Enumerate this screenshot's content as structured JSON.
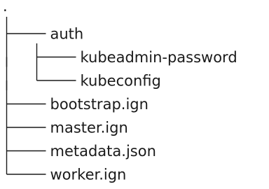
{
  "tree": {
    "root": ".",
    "items": [
      {
        "label": "auth",
        "depth": 0,
        "kind": "dir",
        "last": false
      },
      {
        "label": "kubeadmin-password",
        "depth": 1,
        "kind": "file",
        "last": false
      },
      {
        "label": "kubeconfig",
        "depth": 1,
        "kind": "file",
        "last": true
      },
      {
        "label": "bootstrap.ign",
        "depth": 0,
        "kind": "file",
        "last": false
      },
      {
        "label": "master.ign",
        "depth": 0,
        "kind": "file",
        "last": false
      },
      {
        "label": "metadata.json",
        "depth": 0,
        "kind": "file",
        "last": false
      },
      {
        "label": "worker.ign",
        "depth": 0,
        "kind": "file",
        "last": true
      }
    ]
  }
}
